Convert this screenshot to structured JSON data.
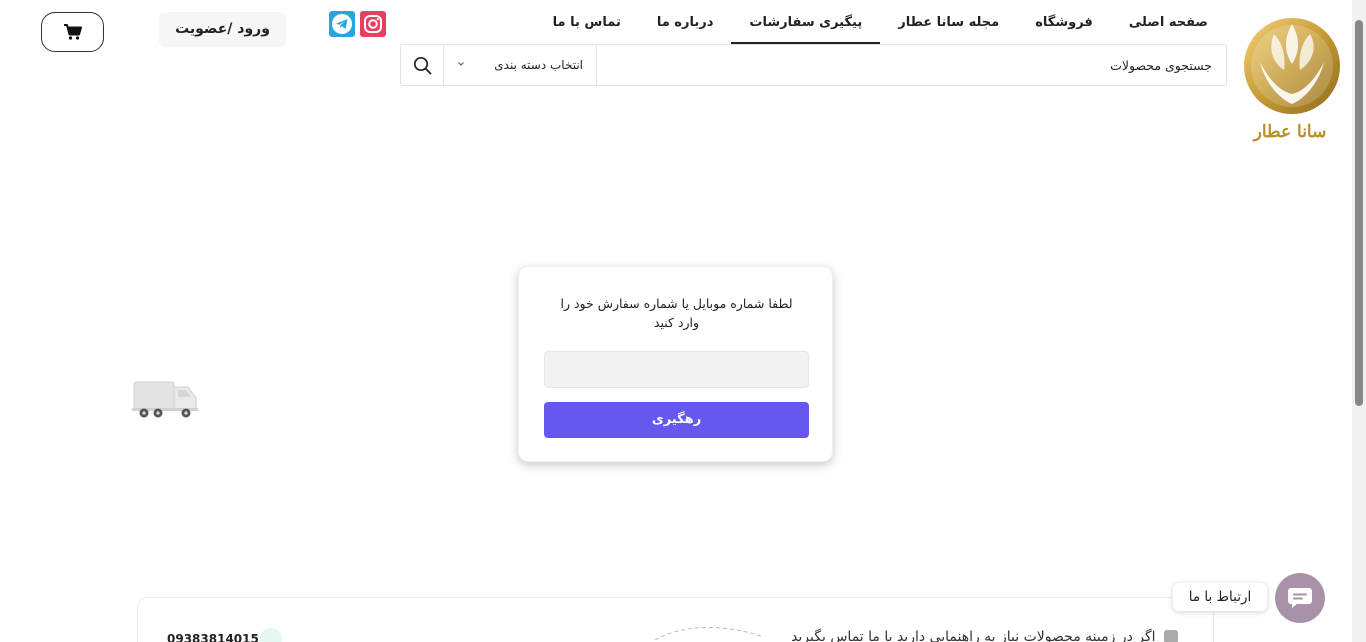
{
  "brand": {
    "logo_text": "سانا عطار"
  },
  "nav": {
    "items": [
      {
        "label": "صفحه اصلی",
        "active": false
      },
      {
        "label": "فروشگاه",
        "active": false
      },
      {
        "label": "مجله سانا عطار",
        "active": false
      },
      {
        "label": "پیگیری سفارشات",
        "active": true
      },
      {
        "label": "درباره ما",
        "active": false
      },
      {
        "label": "تماس با ما",
        "active": false
      }
    ]
  },
  "header": {
    "login_label": "ورود /عضویت",
    "social_icons": [
      "instagram-icon",
      "telegram-icon"
    ]
  },
  "search": {
    "placeholder": "جستجوی محصولات",
    "category_label": "انتخاب دسته بندی"
  },
  "tracking": {
    "message": "لطفا شماره موبایل یا شماره سفارش خود را وارد کنید",
    "input_value": "",
    "button_label": "رهگیری"
  },
  "footer": {
    "phone": "09383814015",
    "help_text": "اگر در زمینه محصولات نیاز به راهنمایی دارید با ما تماس بگیرید"
  },
  "contact": {
    "label": "ارتباط با ما"
  },
  "colors": {
    "accent": "#6558ee",
    "brand_gold": "#b8902b",
    "contact_button": "#a991aa",
    "instagram": "#e4405f",
    "telegram": "#2aa3de"
  }
}
